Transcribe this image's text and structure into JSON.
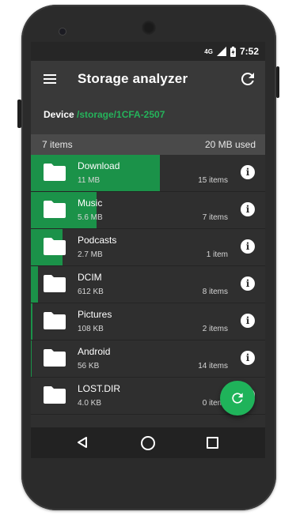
{
  "status_bar": {
    "network": "4G",
    "time": "7:52"
  },
  "app_bar": {
    "title": "Storage analyzer"
  },
  "device": {
    "label": "Device",
    "path": "/storage/1CFA-2507"
  },
  "summary": {
    "count": "7 items",
    "used": "20 MB used"
  },
  "folders": [
    {
      "name": "Download",
      "size": "11 MB",
      "items": "15 items",
      "fraction": 0.55
    },
    {
      "name": "Music",
      "size": "5.6 MB",
      "items": "7 items",
      "fraction": 0.28
    },
    {
      "name": "Podcasts",
      "size": "2.7 MB",
      "items": "1 item",
      "fraction": 0.135
    },
    {
      "name": "DCIM",
      "size": "612 KB",
      "items": "8 items",
      "fraction": 0.03
    },
    {
      "name": "Pictures",
      "size": "108 KB",
      "items": "2 items",
      "fraction": 0.006
    },
    {
      "name": "Android",
      "size": "56 KB",
      "items": "14 items",
      "fraction": 0.003
    },
    {
      "name": "LOST.DIR",
      "size": "4.0 KB",
      "items": "0 items",
      "fraction": 0
    }
  ],
  "colors": {
    "accent": "#25b35b",
    "bar": "#1b9249",
    "fab": "#1fb35a"
  },
  "icons": {
    "menu": "menu-icon",
    "refresh": "refresh-icon",
    "folder": "folder-icon",
    "info": "info-icon",
    "back": "back-icon",
    "home": "home-icon",
    "recents": "recents-icon"
  }
}
